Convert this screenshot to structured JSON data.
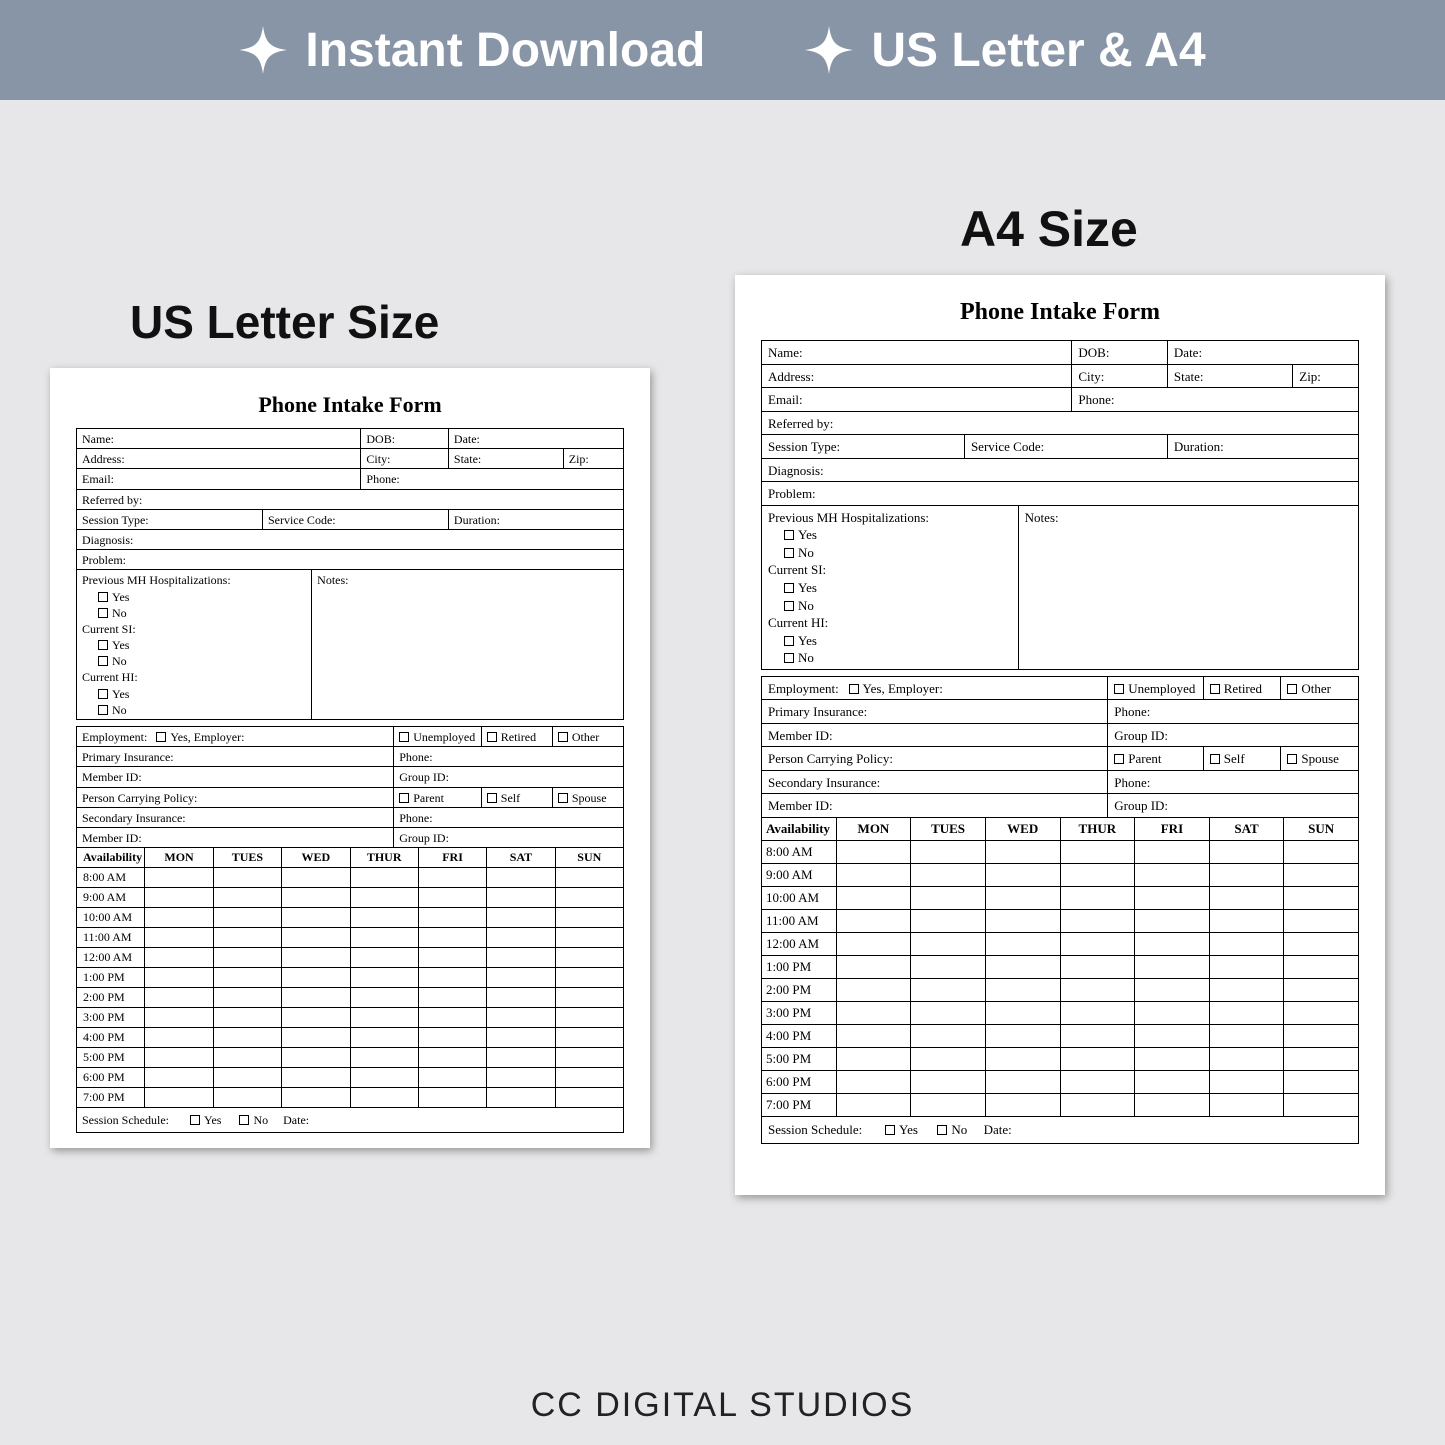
{
  "banner": {
    "item1": "Instant Download",
    "item2": "US Letter & A4"
  },
  "labels": {
    "us": "US Letter Size",
    "a4": "A4 Size"
  },
  "doc": {
    "title": "Phone Intake Form",
    "fields": {
      "name": "Name:",
      "dob": "DOB:",
      "date": "Date:",
      "address": "Address:",
      "city": "City:",
      "state": "State:",
      "zip": "Zip:",
      "email": "Email:",
      "phone": "Phone:",
      "referred": "Referred by:",
      "session_type": "Session Type:",
      "service_code": "Service Code:",
      "duration": "Duration:",
      "diagnosis": "Diagnosis:",
      "problem": "Problem:",
      "prev_mh": "Previous MH Hospitalizations:",
      "yes": "Yes",
      "no": "No",
      "current_si": "Current SI:",
      "current_hi": "Current HI:",
      "notes": "Notes:",
      "employment": "Employment:",
      "yes_employer": "Yes, Employer:",
      "unemployed": "Unemployed",
      "retired": "Retired",
      "other": "Other",
      "primary_ins": "Primary Insurance:",
      "member_id": "Member ID:",
      "group_id": "Group ID:",
      "person_policy": "Person Carrying Policy:",
      "parent": "Parent",
      "self": "Self",
      "spouse": "Spouse",
      "secondary_ins": "Secondary Insurance:",
      "availability": "Availability",
      "session_sched": "Session Schedule:"
    },
    "days": [
      "MON",
      "TUES",
      "WED",
      "THUR",
      "FRI",
      "SAT",
      "SUN"
    ],
    "times": [
      "8:00 AM",
      "9:00 AM",
      "10:00 AM",
      "11:00 AM",
      "12:00 AM",
      "1:00 PM",
      "2:00 PM",
      "3:00 PM",
      "4:00 PM",
      "5:00 PM",
      "6:00 PM",
      "7:00 PM"
    ]
  },
  "footer": "CC DIGITAL STUDIOS"
}
